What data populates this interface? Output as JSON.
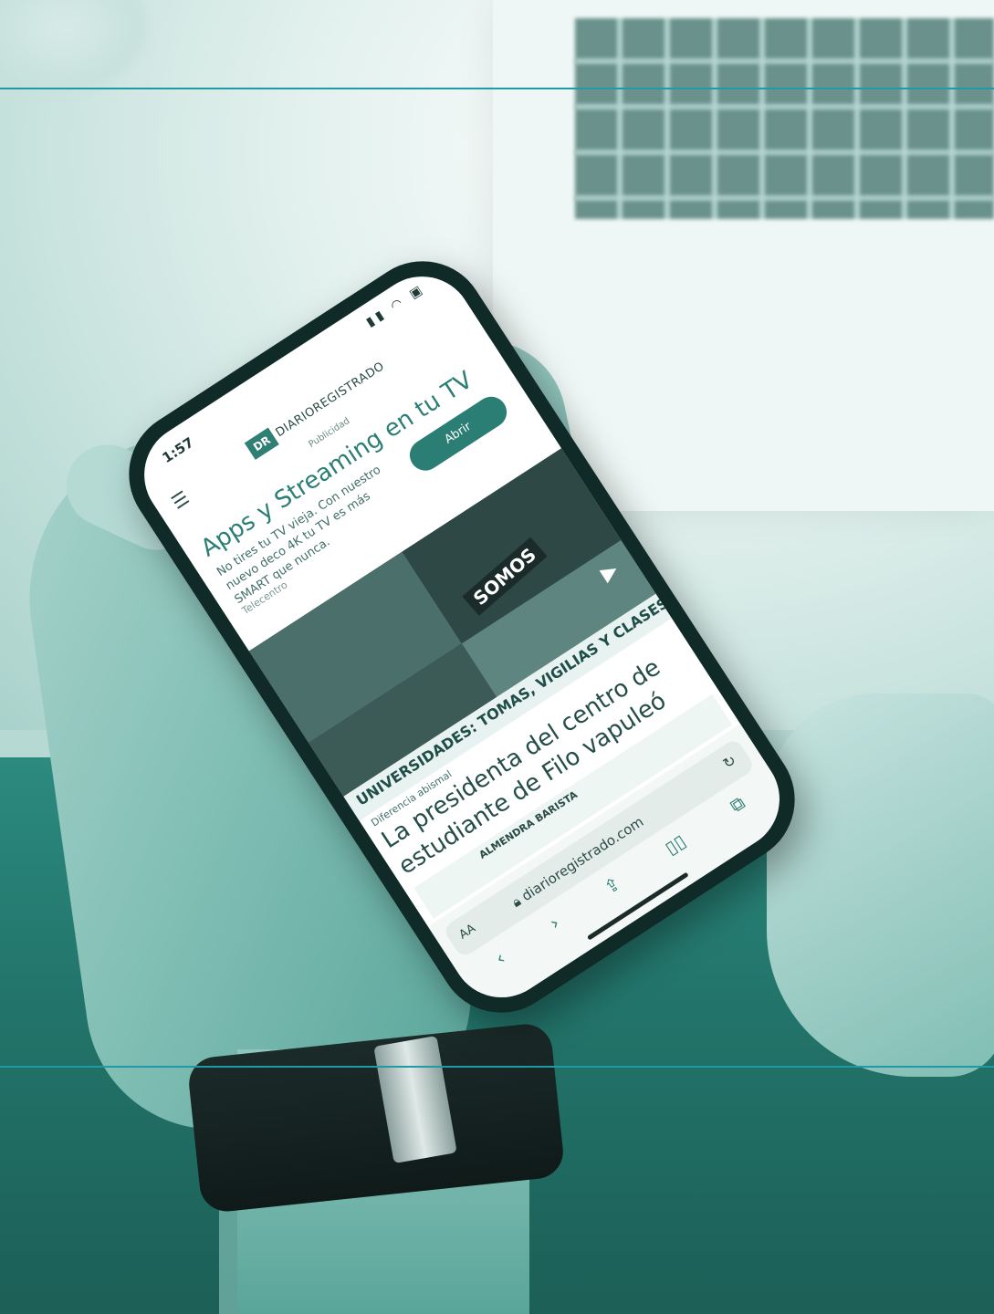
{
  "phone": {
    "status_time": "1:57",
    "logo_abbr": "DR",
    "logo_text": "DIARIOREGISTRADO",
    "ad_label": "Publicidad",
    "ad": {
      "title": "Apps y Streaming en tu TV",
      "text": "No tires tu TV vieja. Con nuestro nuevo deco 4K tu TV es más SMART que nunca.",
      "button": "Abrir",
      "brand": "Telecentro"
    },
    "video_overlay": "SOMOS",
    "banner": "UNIVERSIDADES: TOMAS, VIGILIAS Y CLASES EN LA CALLE",
    "tag": "Diferencia abismal",
    "headline": "La presidenta del centro de estudiante de Filo vapuleó",
    "ad2": "ALMENDRA BARISTA",
    "browser": {
      "aa_label": "AA",
      "url": "diarioregistrado.com"
    }
  },
  "icons": {
    "menu": "menu-icon",
    "play": "play-icon",
    "reload": "reload-icon",
    "lock": "lock-icon",
    "back": "back-icon",
    "forward": "forward-icon",
    "share": "share-icon",
    "bookmarks": "book-icon",
    "tabs": "tabs-icon"
  },
  "colors": {
    "accent": "#2b7e74",
    "rule": "#1f9aa6"
  }
}
